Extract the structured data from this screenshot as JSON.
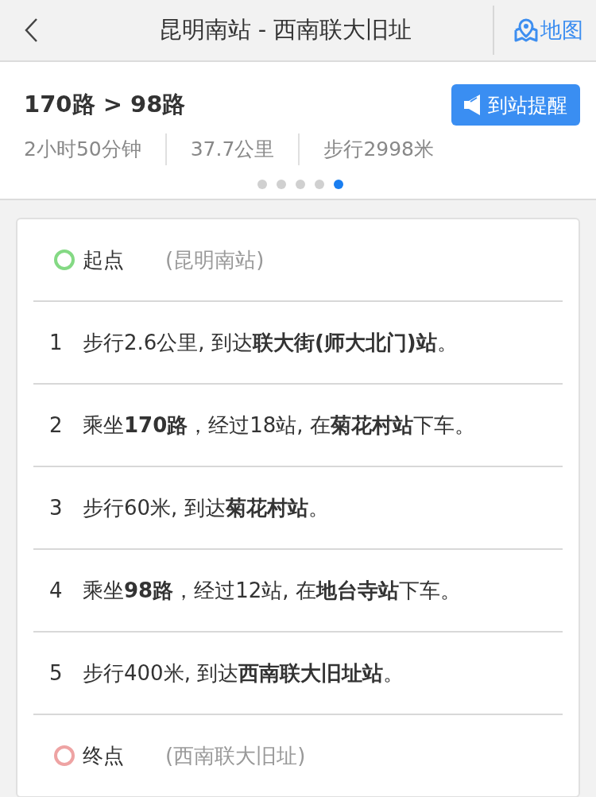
{
  "header": {
    "title": "昆明南站 - 西南联大旧址",
    "map_label": "地图"
  },
  "summary": {
    "routes": "170路 > 98路",
    "alert_button": "到站提醒",
    "stats": [
      "2小时50分钟",
      "37.7公里",
      "步行2998米"
    ],
    "pages": [
      {
        "selected": false
      },
      {
        "selected": false
      },
      {
        "selected": false
      },
      {
        "selected": false
      },
      {
        "selected": true
      }
    ]
  },
  "steps": [
    {
      "kind": "endpoint",
      "label": "起点",
      "place": "(昆明南站)",
      "color": "#84d984"
    },
    {
      "kind": "step",
      "number": "1",
      "text": "步行2.6公里, 到达**联大街(师大北门)站**。"
    },
    {
      "kind": "step",
      "number": "2",
      "text": "乘坐**170路**，经过18站, 在**菊花村站**下车。"
    },
    {
      "kind": "step",
      "number": "3",
      "text": "步行60米, 到达**菊花村站**。"
    },
    {
      "kind": "step",
      "number": "4",
      "text": "乘坐**98路**，经过12站, 在**地台寺站**下车。"
    },
    {
      "kind": "step",
      "number": "5",
      "text": "步行400米, 到达**西南联大旧址站**。"
    },
    {
      "kind": "endpoint",
      "label": "终点",
      "place": "(西南联大旧址)",
      "color": "#eea3a3"
    }
  ]
}
